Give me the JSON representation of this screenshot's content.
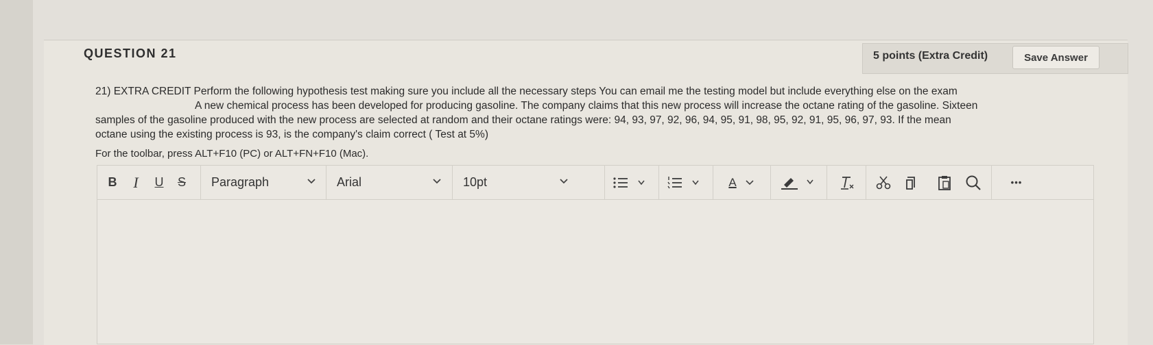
{
  "question": {
    "title": "QUESTION 21",
    "points": "5 points (Extra Credit)",
    "save_label": "Save Answer",
    "line1": "21) EXTRA CREDIT   Perform the following hypothesis test making sure you include all the necessary steps   You can email me the testing model but include everything else on the exam",
    "line2": "A new chemical process has been developed for producing gasoline.  The company claims that this new process will increase the octane rating of the gasoline.  Sixteen",
    "line3": "samples  of the gasoline produced with the new process are selected at random and their octane ratings were:  94, 93, 97, 92, 96, 94, 95, 91, 98, 95, 92, 91, 95, 96, 97, 93.  If the mean",
    "line4": "octane using the existing process is 93, is the company's claim correct ( Test at 5%)"
  },
  "editor": {
    "toolbar_hint": "For the toolbar, press ALT+F10 (PC) or ALT+FN+F10 (Mac).",
    "bold": "B",
    "italic": "I",
    "underline": "U",
    "strike": "S",
    "paragraph": "Paragraph",
    "font": "Arial",
    "size": "10pt",
    "text_color_letter": "A",
    "more": "•••",
    "body_text": ""
  },
  "icons": [
    "bold-icon",
    "italic-icon",
    "underline-icon",
    "strikethrough-icon",
    "bullet-list-icon",
    "numbered-list-icon",
    "text-color-icon",
    "highlight-icon",
    "clear-formatting-icon",
    "cut-icon",
    "copy-icon",
    "paste-icon",
    "search-icon",
    "more-icon",
    "chevron-down-icon"
  ]
}
